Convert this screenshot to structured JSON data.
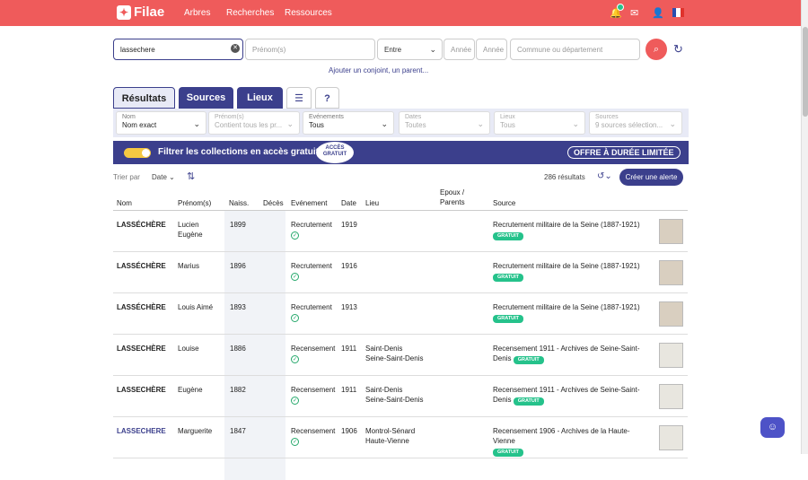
{
  "header": {
    "logo": "Filae",
    "nav": [
      "Arbres",
      "Recherches",
      "Ressources"
    ]
  },
  "search": {
    "name_value": "lassechere",
    "firstname_placeholder": "Prénom(s)",
    "range_select": "Entre",
    "year1_placeholder": "Année",
    "year2_placeholder": "Année",
    "place_placeholder": "Commune ou département",
    "add_link": "Ajouter un conjoint, un parent..."
  },
  "tabs": [
    "Résultats",
    "Sources",
    "Lieux",
    "?"
  ],
  "filters": [
    {
      "label": "Nom",
      "value": "Nom exact"
    },
    {
      "label": "Prénom(s)",
      "value": "Contient tous les pr..."
    },
    {
      "label": "Evénements",
      "value": "Tous"
    },
    {
      "label": "Dates",
      "value": "Toutes"
    },
    {
      "label": "Lieux",
      "value": "Tous"
    },
    {
      "label": "Sources",
      "value": "9 sources sélection..."
    }
  ],
  "banner": {
    "text": "Filtrer les collections en accès gratuit",
    "badge_line1": "ACCÈS",
    "badge_line2": "GRATUIT",
    "offer": "OFFRE À DURÉE LIMITÉE"
  },
  "toolbar": {
    "sort_label": "Trier par",
    "sort_value": "Date",
    "count": "286 résultats",
    "alert_button": "Créer une alerte"
  },
  "table": {
    "headers": {
      "nom": "Nom",
      "prenoms": "Prénom(s)",
      "naiss": "Naiss.",
      "deces": "Décès",
      "evenement": "Evénement",
      "date": "Date",
      "lieu": "Lieu",
      "epoux": "Epoux / Parents",
      "source": "Source"
    },
    "free_tag": "GRATUIT",
    "rows": [
      {
        "nom": "LASSÉCHÈRE",
        "prenom_1": "Lucien",
        "prenom_2": "Eugène",
        "naiss": "1899",
        "evenement": "Recrutement",
        "date": "1919",
        "lieu_1": "",
        "lieu_2": "",
        "source_1": "Recrutement militaire de la Seine (1887-1921)",
        "source_2": ""
      },
      {
        "nom": "LASSÉCHÈRE",
        "prenom_1": "Marius",
        "prenom_2": "",
        "naiss": "1896",
        "evenement": "Recrutement",
        "date": "1916",
        "lieu_1": "",
        "lieu_2": "",
        "source_1": "Recrutement militaire de la Seine (1887-1921)",
        "source_2": ""
      },
      {
        "nom": "LASSÉCHÈRE",
        "prenom_1": "Louis Aimé",
        "prenom_2": "",
        "naiss": "1893",
        "evenement": "Recrutement",
        "date": "1913",
        "lieu_1": "",
        "lieu_2": "",
        "source_1": "Recrutement militaire de la Seine (1887-1921)",
        "source_2": ""
      },
      {
        "nom": "LASSECHÈRE",
        "prenom_1": "Louise",
        "prenom_2": "",
        "naiss": "1886",
        "evenement": "Recensement",
        "date": "1911",
        "lieu_1": "Saint-Denis",
        "lieu_2": "Seine-Saint-Denis",
        "source_1": "Recensement 1911 - Archives de Seine-Saint-",
        "source_2": "Denis"
      },
      {
        "nom": "LASSECHÈRE",
        "prenom_1": "Eugène",
        "prenom_2": "",
        "naiss": "1882",
        "evenement": "Recensement",
        "date": "1911",
        "lieu_1": "Saint-Denis",
        "lieu_2": "Seine-Saint-Denis",
        "source_1": "Recensement 1911 - Archives de Seine-Saint-",
        "source_2": "Denis"
      },
      {
        "nom": "LASSECHERE",
        "prenom_1": "Marguerite",
        "prenom_2": "",
        "naiss": "1847",
        "evenement": "Recensement",
        "date": "1906",
        "lieu_1": "Montrol-Sénard",
        "lieu_2": "Haute-Vienne",
        "source_1": "Recensement 1906 - Archives de la Haute-Vienne",
        "source_2": ""
      }
    ]
  }
}
